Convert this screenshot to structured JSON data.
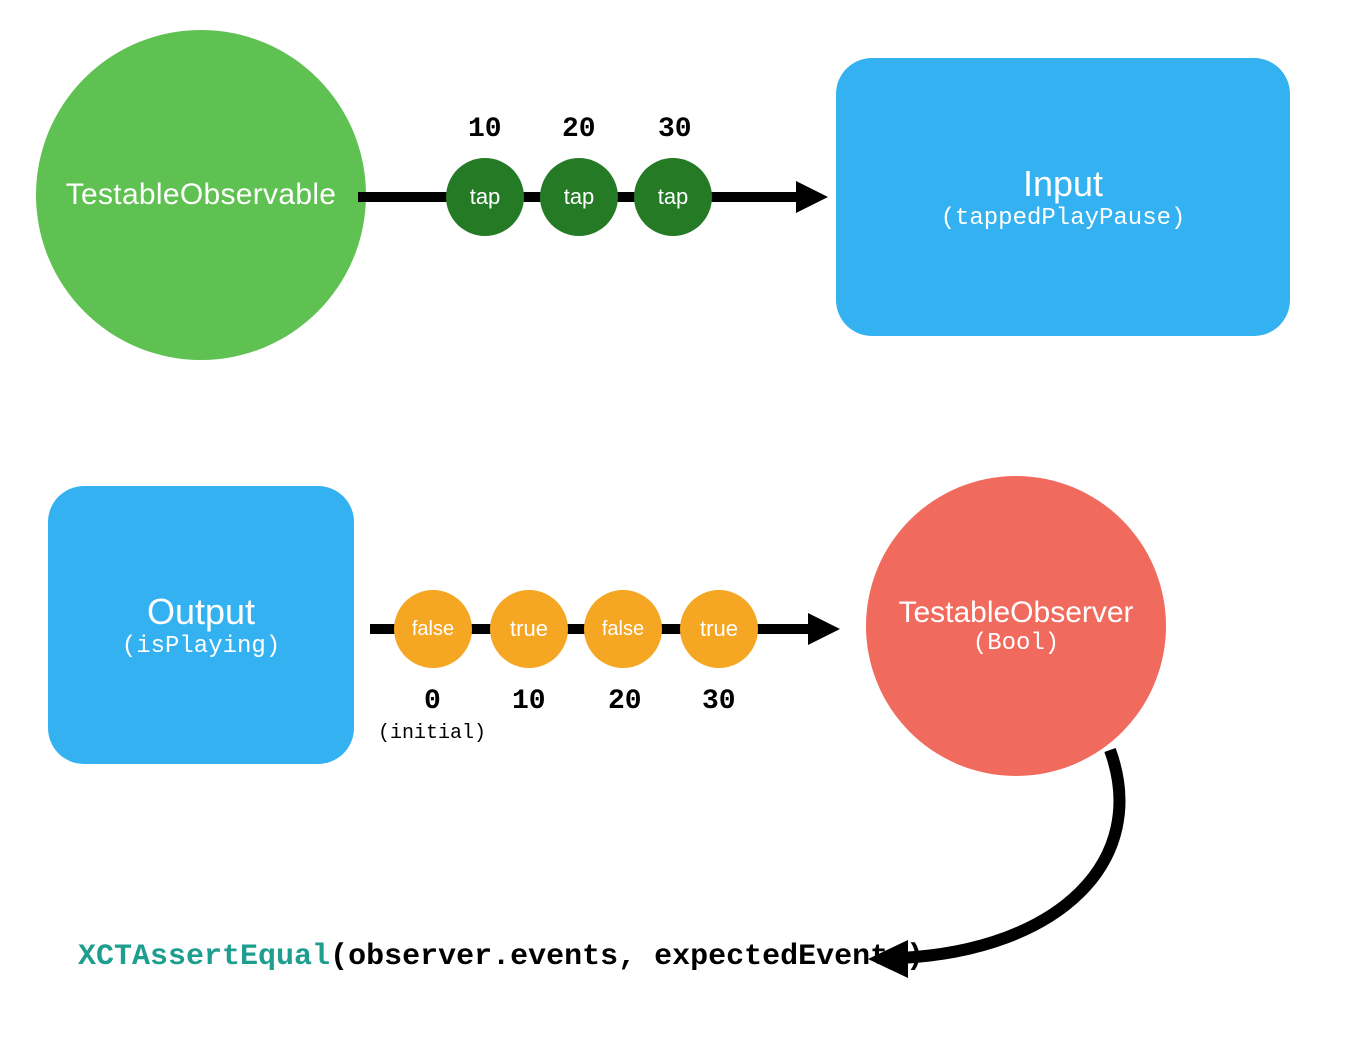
{
  "colors": {
    "green": "#5fc151",
    "darkGreen": "#257a25",
    "blue": "#33b1f1",
    "orange": "#f5a623",
    "red": "#f16a5e",
    "teal": "#1e9e8f"
  },
  "source": {
    "label": "TestableObservable"
  },
  "inputBox": {
    "title": "Input",
    "paramOpen": "(",
    "param": "tappedPlayPause",
    "paramClose": ")"
  },
  "outputBox": {
    "title": "Output",
    "paramOpen": "(",
    "param": "isPlaying",
    "paramClose": ")"
  },
  "observer": {
    "title": "TestableObserver",
    "paramOpen": "(",
    "param": "Bool",
    "paramClose": ")"
  },
  "topEvents": {
    "items": [
      {
        "time": "10",
        "label": "tap"
      },
      {
        "time": "20",
        "label": "tap"
      },
      {
        "time": "30",
        "label": "tap"
      }
    ]
  },
  "bottomEvents": {
    "items": [
      {
        "time": "0",
        "label": "false"
      },
      {
        "time": "10",
        "label": "true"
      },
      {
        "time": "20",
        "label": "false"
      },
      {
        "time": "30",
        "label": "true"
      }
    ],
    "initialNote": "(initial)"
  },
  "assertion": {
    "fn": "XCTAssertEqual",
    "argsOpen": "(",
    "arg1": "observer.events",
    "sep": ", ",
    "arg2": "expectedEvents",
    "argsClose": ")"
  }
}
